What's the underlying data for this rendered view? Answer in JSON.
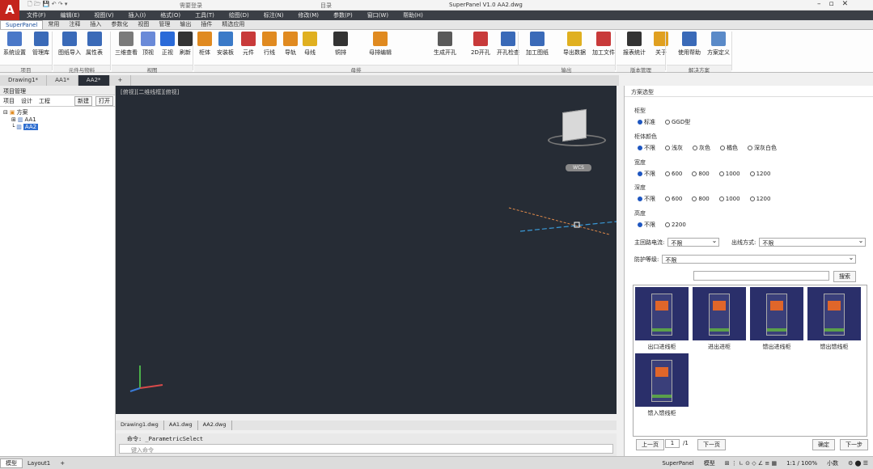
{
  "window": {
    "title": "SuperPanel V1.0 AA2.dwg",
    "left_hint": "需要登录",
    "mid_hint": "目录"
  },
  "menubar": [
    "文件(F)",
    "编辑(E)",
    "视图(V)",
    "插入(I)",
    "格式(O)",
    "工具(T)",
    "绘图(D)",
    "标注(N)",
    "修改(M)",
    "参数(P)",
    "窗口(W)",
    "帮助(H)"
  ],
  "ribbon_tabs": [
    "SuperPanel",
    "常用",
    "注释",
    "插入",
    "参数化",
    "视图",
    "管理",
    "输出",
    "插件",
    "精选应用"
  ],
  "ribbon": {
    "buttons": [
      {
        "label": "系统设置",
        "color": "#4a78c8"
      },
      {
        "label": "管理库",
        "color": "#3a6ab8"
      },
      {
        "label": "图纸导入",
        "color": "#3a6ab8"
      },
      {
        "label": "属性表",
        "color": "#3a6ab8"
      },
      {
        "label": "三维查看",
        "color": "#7a7a7a"
      },
      {
        "label": "顶视",
        "color": "#6a8ad8"
      },
      {
        "label": "正视",
        "color": "#2a6ad8"
      },
      {
        "label": "刷新",
        "color": "#333333"
      },
      {
        "label": "柜体",
        "color": "#e08a20"
      },
      {
        "label": "安装板",
        "color": "#3a7ac8"
      },
      {
        "label": "元件",
        "color": "#c83a3a"
      },
      {
        "label": "行线",
        "color": "#e08a20"
      },
      {
        "label": "导轨",
        "color": "#e08a20"
      },
      {
        "label": "母线",
        "color": "#e0b020"
      },
      {
        "label": "铜排",
        "color": "#333333"
      },
      {
        "label": "母排编辑",
        "color": "#e08a20"
      },
      {
        "label": "生成开孔",
        "color": "#5a5a5a"
      },
      {
        "label": "2D开孔",
        "color": "#c83a3a"
      },
      {
        "label": "开孔检查",
        "color": "#3a6ab8"
      },
      {
        "label": "加工图纸",
        "color": "#3a6ab8"
      },
      {
        "label": "导出数据",
        "color": "#e0b020"
      },
      {
        "label": "加工文件",
        "color": "#c83a3a"
      },
      {
        "label": "报表统计",
        "color": "#333333"
      },
      {
        "label": "关于",
        "color": "#e0a020"
      },
      {
        "label": "使用帮助",
        "color": "#3a6ab8"
      },
      {
        "label": "方案定义",
        "color": "#5a8ac8"
      }
    ],
    "groups": [
      "项目",
      "元件与物料",
      "视图",
      "母排",
      "输出",
      "版本管理",
      "解决方案"
    ]
  },
  "doc_tabs": [
    "Drawing1*",
    "AA1*",
    "AA2*"
  ],
  "left_panel": {
    "title": "项目管理",
    "tabs": [
      "项目",
      "设计",
      "工程"
    ],
    "buttons": [
      "新建",
      "打开"
    ],
    "tree": {
      "root": "方案",
      "children": [
        "AA1",
        "AA2"
      ]
    }
  },
  "viewport": {
    "label": "[俯视][二维线框][俯视]",
    "wcs": "WCS"
  },
  "bottom_tabs": [
    "Drawing1.dwg",
    "AA1.dwg",
    "AA2.dwg"
  ],
  "command": {
    "history": "命令: _ParametricSelect",
    "prompt": "键入命令"
  },
  "right_panel": {
    "title": "方案选型",
    "groups": [
      {
        "label": "柜型",
        "options": [
          "标准",
          "GGD型"
        ],
        "selected": 0
      },
      {
        "label": "柜体颜色",
        "options": [
          "不限",
          "浅灰",
          "灰色",
          "橘色",
          "深灰白色"
        ],
        "selected": 0
      },
      {
        "label": "宽度",
        "options": [
          "不限",
          "600",
          "800",
          "1000",
          "1200"
        ],
        "selected": 0
      },
      {
        "label": "深度",
        "options": [
          "不限",
          "600",
          "800",
          "1000",
          "1200"
        ],
        "selected": 0
      },
      {
        "label": "高度",
        "options": [
          "不限",
          "2200"
        ],
        "selected": 0
      }
    ],
    "selects": [
      {
        "label": "主回路电流:",
        "value": "不限"
      },
      {
        "label": "出线方式:",
        "value": "不限"
      },
      {
        "label": "防护等级:",
        "value": "不限"
      }
    ],
    "search_button": "搜索",
    "thumbnails": [
      "出口进线柜",
      "进出进柜",
      "馈出进线柜",
      "馈出馈线柜",
      "馈入馈线柜"
    ],
    "pager": {
      "prev": "上一页",
      "page": "1",
      "total": "/1",
      "next": "下一页",
      "confirm": "确定",
      "cancel": "下一步"
    }
  },
  "statusbar": {
    "model": "模型",
    "layout": "Layout1",
    "app": "SuperPanel",
    "mode": "模型",
    "scale": "1:1 / 100%",
    "units": "小数"
  }
}
